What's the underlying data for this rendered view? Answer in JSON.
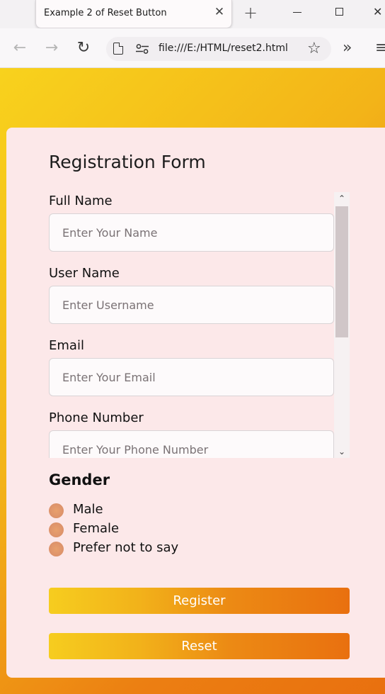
{
  "browser": {
    "tab_title": "Example 2 of Reset Button",
    "tab_close": "✕",
    "new_tab": "+",
    "window_close": "✕",
    "url": "file:///E:/HTML/reset2.html",
    "back_icon": "←",
    "forward_icon": "→",
    "reload_icon": "↻",
    "star_icon": "☆",
    "overflow_icon": "»",
    "menu_icon": "≡"
  },
  "form": {
    "title": "Registration Form",
    "fields": [
      {
        "label": "Full Name",
        "placeholder": "Enter Your Name"
      },
      {
        "label": "User Name",
        "placeholder": "Enter Username"
      },
      {
        "label": "Email",
        "placeholder": "Enter Your Email"
      },
      {
        "label": "Phone Number",
        "placeholder": "Enter Your Phone Number"
      }
    ],
    "scroll_up": "⌃",
    "scroll_down": "⌄",
    "gender": {
      "title": "Gender",
      "options": [
        "Male",
        "Female",
        "Prefer not to say"
      ]
    },
    "register_label": "Register",
    "reset_label": "Reset"
  },
  "colors": {
    "page_gradient_start": "#f8d21d",
    "page_gradient_end": "#e9700f",
    "card_background": "#fce8e9",
    "radio_fill": "#de946b"
  }
}
